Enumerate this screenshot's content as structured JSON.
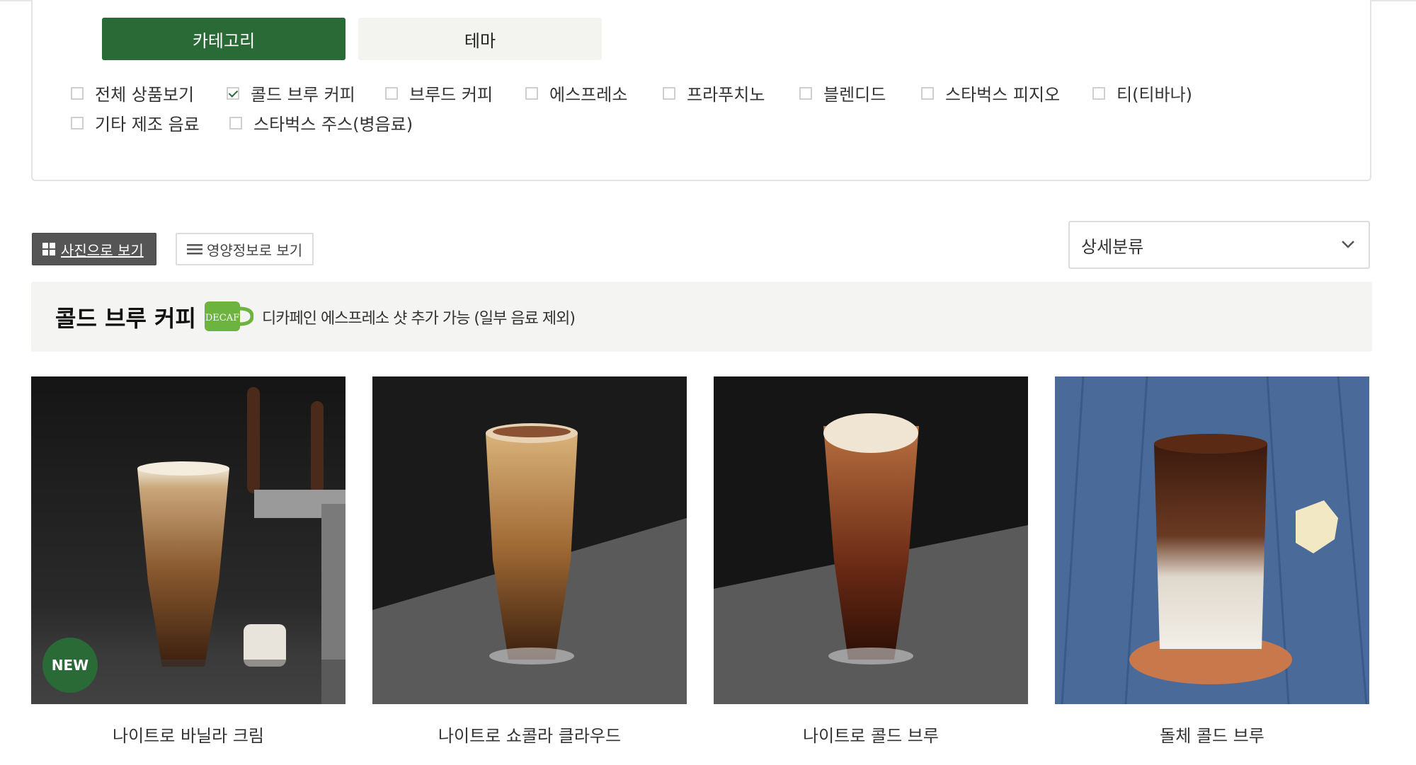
{
  "tabs": {
    "category": "카테고리",
    "theme": "테마"
  },
  "categories": [
    {
      "label": "전체 상품보기",
      "checked": false
    },
    {
      "label": "콜드 브루 커피",
      "checked": true
    },
    {
      "label": "브루드 커피",
      "checked": false
    },
    {
      "label": "에스프레소",
      "checked": false
    },
    {
      "label": "프라푸치노",
      "checked": false
    },
    {
      "label": "블렌디드",
      "checked": false
    },
    {
      "label": "스타벅스 피지오",
      "checked": false
    },
    {
      "label": "티(티바나)",
      "checked": false
    },
    {
      "label": "기타 제조 음료",
      "checked": false
    },
    {
      "label": "스타벅스 주스(병음료)",
      "checked": false
    }
  ],
  "view": {
    "photo_label": "사진으로 보기",
    "nutrition_label": "영양정보로 보기"
  },
  "select": {
    "value": "상세분류"
  },
  "section": {
    "title": "콜드 브루 커피",
    "decaf_logo_text": "DECAF",
    "note": "디카페인 에스프레소 샷 추가 가능 (일부 음료 제외)"
  },
  "products": [
    {
      "name": "나이트로 바닐라 크림",
      "badge": "NEW"
    },
    {
      "name": "나이트로 쇼콜라 클라우드"
    },
    {
      "name": "나이트로 콜드 브루"
    },
    {
      "name": "돌체 콜드 브루"
    }
  ],
  "colors": {
    "accent": "#2a6a37",
    "decaf": "#6db33f"
  }
}
